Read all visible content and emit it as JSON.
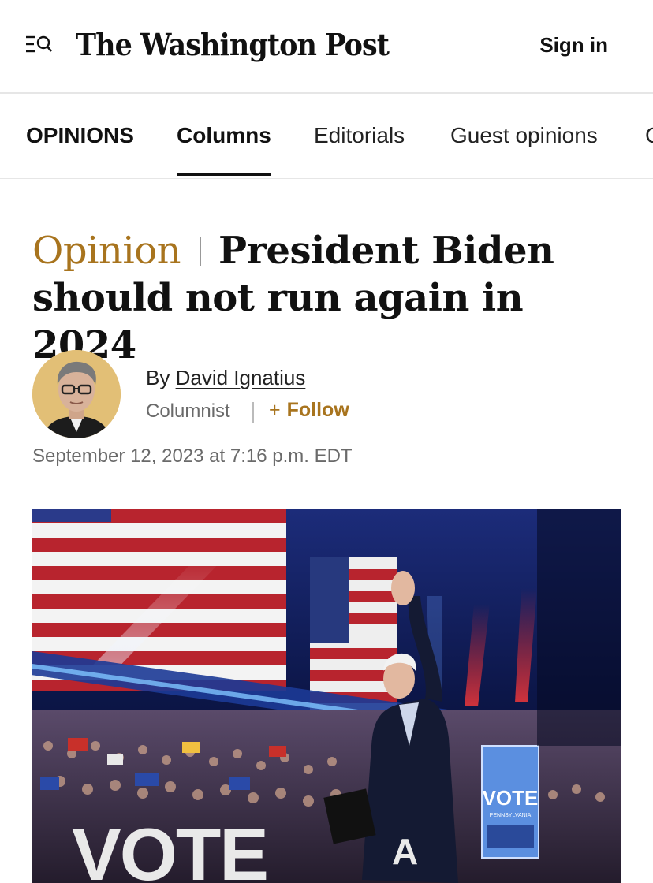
{
  "header": {
    "logo_text": "The Washington Post",
    "sign_in_label": "Sign in",
    "menu_icon": "menu-search-icon"
  },
  "nav": {
    "items": [
      {
        "label": "OPINIONS"
      },
      {
        "label": "Columns"
      },
      {
        "label": "Editorials"
      },
      {
        "label": "Guest opinions"
      },
      {
        "label": "C"
      }
    ],
    "active": "Columns"
  },
  "article": {
    "kicker": "Opinion",
    "title": "President Biden should not run again in 2024",
    "byline_prefix": "By",
    "author": "David Ignatius",
    "role": "Columnist",
    "follow_plus": "+",
    "follow_label": "Follow",
    "timestamp": "September 12, 2023 at 7:16 p.m. EDT"
  },
  "photo": {
    "signs": {
      "vote_big": "VOTE",
      "vote_side": "VOTE",
      "pennsylvania": "PENNSYLVANIA",
      "letter_a": "A"
    }
  },
  "colors": {
    "accent": "#a8741e",
    "text": "#111111",
    "muted": "#6a6a6a"
  }
}
